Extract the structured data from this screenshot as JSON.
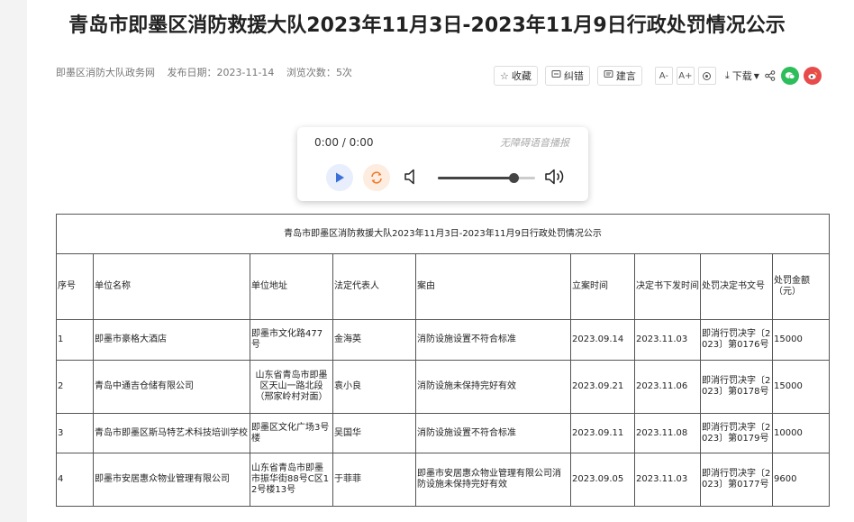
{
  "article": {
    "title": "青岛市即墨区消防救援大队2023年11月3日-2023年11月9日行政处罚情况公示",
    "source": "即墨区消防大队政务网",
    "date_label": "发布日期：",
    "date": "2023-11-14",
    "views_label": "浏览次数：",
    "views": "5次"
  },
  "toolbar": {
    "favorite": "收藏",
    "correct": "纠错",
    "suggest": "建言",
    "font_decrease": "A-",
    "font_increase": "A+",
    "download": "下载",
    "colors": {
      "wechat": "#2dbd5a",
      "weibo": "#e84b4b",
      "accent": "#3c6fd8"
    },
    "icons": [
      "star-icon",
      "edit-icon",
      "comment-icon",
      "font-decrease-icon",
      "font-increase-icon",
      "reset-icon",
      "download-icon",
      "share-icon",
      "wechat-icon",
      "weibo-icon"
    ]
  },
  "player": {
    "time": "0:00 / 0:00",
    "accessibility_label": "无障碍语音播报",
    "volume_level": 0.78
  },
  "table": {
    "caption": "青岛市即墨区消防救援大队2023年11月3日-2023年11月9日行政处罚情况公示",
    "headers": [
      "序号",
      "单位名称",
      "单位地址",
      "法定代表人",
      "案由",
      "立案时间",
      "决定书下发时间",
      "处罚决定书文号",
      "处罚金额（元）"
    ],
    "rows": [
      [
        "1",
        "即墨市豪格大酒店",
        "即墨市文化路477号",
        "金海英",
        "消防设施设置不符合标准",
        "2023.09.14",
        "2023.11.03",
        "即消行罚决字〔2023〕第0176号",
        "15000"
      ],
      [
        "2",
        "青岛中通吉仓储有限公司",
        "山东省青岛市即墨区天山一路北段（邢家岭村对面）",
        "袁小良",
        "消防设施未保持完好有效",
        "2023.09.21",
        "2023.11.06",
        "即消行罚决字〔2023〕第0178号",
        "15000"
      ],
      [
        "3",
        "青岛市即墨区斯马特艺术科技培训学校",
        "即墨区文化广场3号楼",
        "吴国华",
        "消防设施设置不符合标准",
        "2023.09.11",
        "2023.11.08",
        "即消行罚决字〔2023〕第0179号",
        "10000"
      ],
      [
        "4",
        "即墨市安居惠众物业管理有限公司",
        "山东省青岛市即墨市振华街88号C区12号楼13号",
        "于菲菲",
        "即墨市安居惠众物业管理有限公司消防设施未保持完好有效",
        "2023.09.05",
        "2023.11.03",
        "即消行罚决字〔2023〕第0177号",
        "9600"
      ]
    ]
  }
}
